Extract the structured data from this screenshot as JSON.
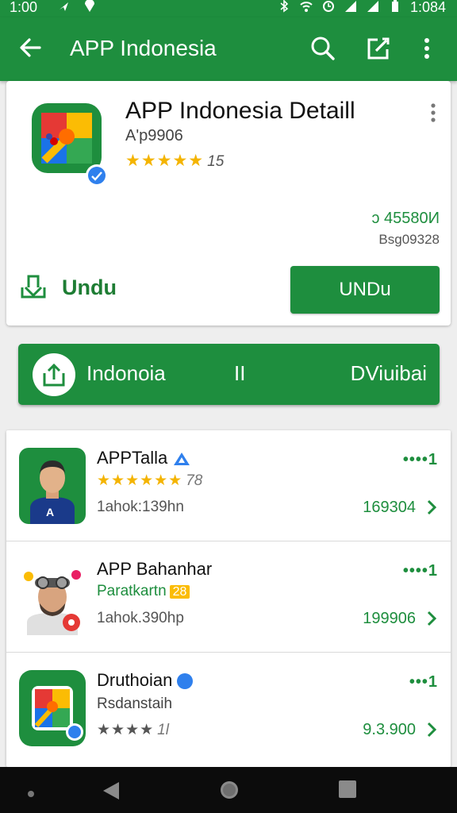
{
  "status": {
    "time": "1:00",
    "right_text": "1:084"
  },
  "appbar": {
    "title": "APP Indonesia"
  },
  "detail": {
    "title": "APP Indonesia Detaill",
    "subtitle": "A'p9906",
    "stars": "★★★★★",
    "rating_count": "15",
    "price": "ɔ 45580И",
    "size": "Bsg09328",
    "download_link": "Undu",
    "download_button": "UNDu"
  },
  "banner": {
    "left": "Indonoia",
    "middle": "II",
    "right": "DViuibai"
  },
  "list": [
    {
      "name": "APPTalla",
      "stars": "★★★★★★",
      "rating": "78",
      "meta": "1ahok:139hn",
      "dots": "••••1",
      "value": "169304"
    },
    {
      "name": "APP Bahanhar",
      "tag": "Paratkartn",
      "tag_badge": "28",
      "meta": "1ahok.390hp",
      "dots": "••••1",
      "value": "199906"
    },
    {
      "name": "Druthoian",
      "sub": "Rsdanstaih",
      "stars": "★★★★",
      "rating": "1l",
      "dots": "•••1",
      "value": "9.3.900"
    }
  ]
}
